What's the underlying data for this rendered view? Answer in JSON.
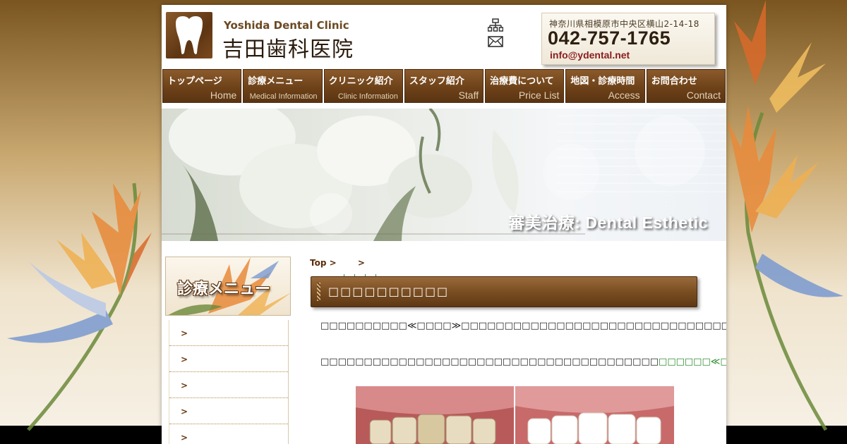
{
  "header": {
    "clinic_name_en": "Yoshida Dental Clinic",
    "clinic_name_jp": "吉田歯科医院",
    "address": "神奈川県相模原市中央区横山2-14-18",
    "phone": "042-757-1765",
    "email": "info@ydental.net"
  },
  "nav": {
    "items": [
      {
        "jp": "トップページ",
        "en": "Home"
      },
      {
        "jp": "診療メニュー",
        "en": "Medical Information"
      },
      {
        "jp": "クリニック紹介",
        "en": "Clinic Information"
      },
      {
        "jp": "スタッフ紹介",
        "en": "Staff"
      },
      {
        "jp": "治療費について",
        "en": "Price List"
      },
      {
        "jp": "地図・診療時間",
        "en": "Access"
      },
      {
        "jp": "お問合わせ",
        "en": "Contact"
      }
    ]
  },
  "banner": {
    "title": "審美治療: Dental Esthetic"
  },
  "sidebar": {
    "heading": "診療メニュー",
    "items": [
      {
        "marker": ">"
      },
      {
        "marker": ">"
      },
      {
        "marker": ">"
      },
      {
        "marker": ">"
      },
      {
        "marker": ">"
      }
    ]
  },
  "breadcrumb": {
    "top": "Top",
    "sep1": ">",
    "sep2": ">"
  },
  "content": {
    "section_title": "□□□□□□□□□□",
    "para1": "□□□□□□□□□□≪□□□□≫□□□□□□□□□□□□□□□□□□□□□□□□□□□□□□□□□□□□□□□□□□□□□□□□□□□□□□□□□□□□□□□□□□□□□□□",
    "para2_a": "□□□□□□□□□□□□□□□□□□□□□□□□□□□□□□□□□□□□□□□",
    "para2_hl": "□□□□□□≪□□□□≫□□□",
    "para2_b": "□□□□□□□□□□□□□□□□□□□□□□□□□□□□□□□□□□□□□□□□□□□□□□□□□□□□□□□□"
  },
  "colors": {
    "nav_brown": "#6e4219",
    "email_red": "#8a1c1c",
    "highlight_green": "#2e8b2e"
  }
}
